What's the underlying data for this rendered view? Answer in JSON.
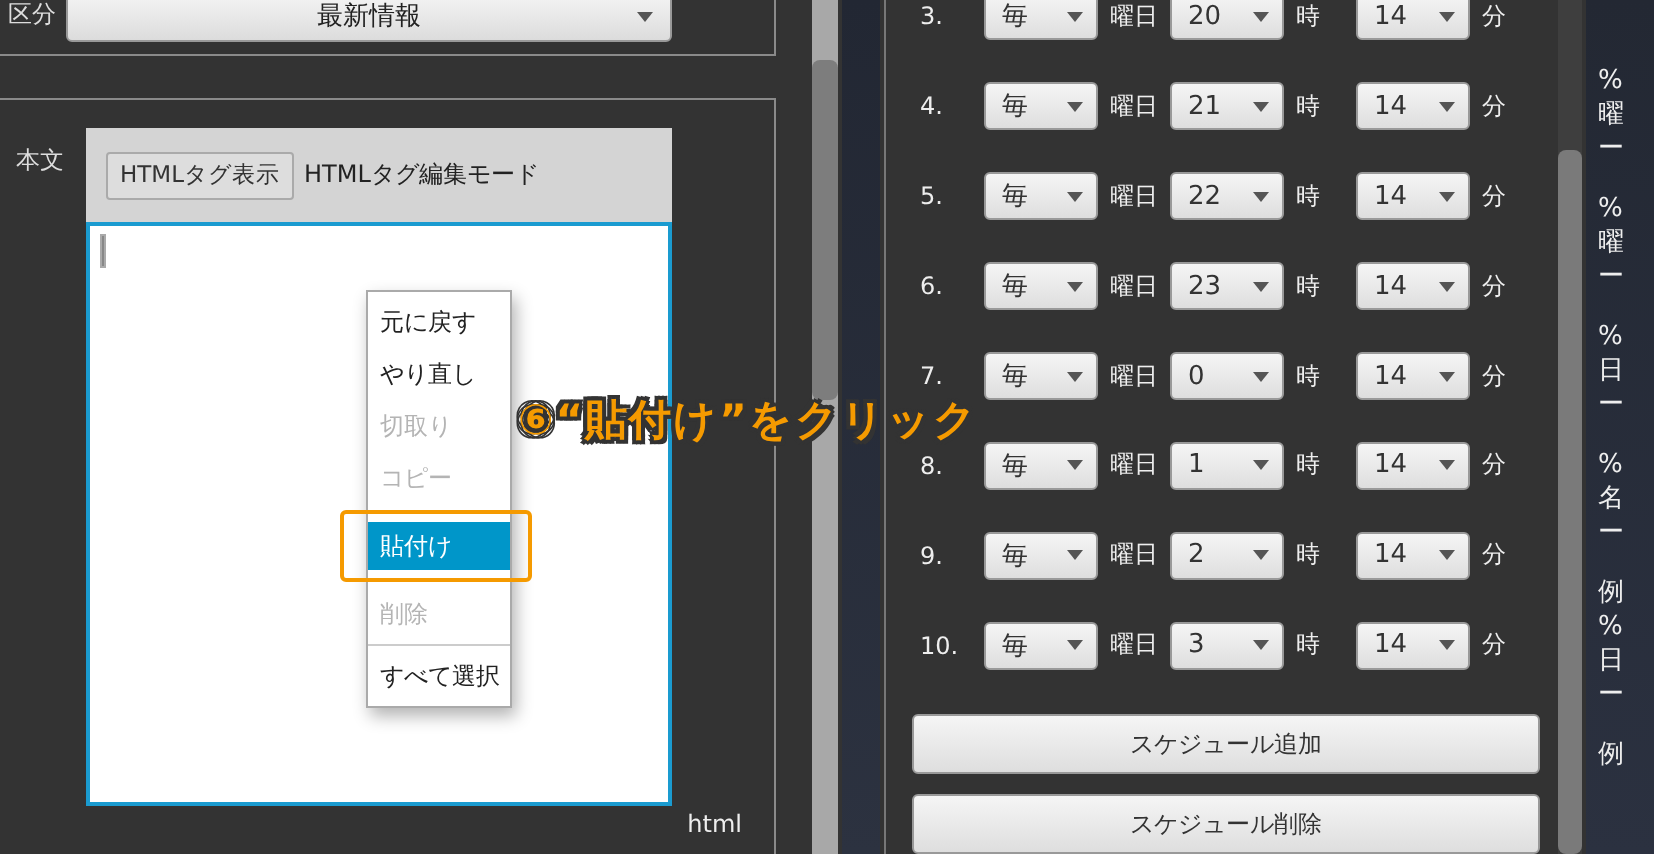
{
  "category_field": {
    "label": "区分",
    "value": "最新情報"
  },
  "body_editor": {
    "label": "本文",
    "toggle_button": "HTMLタグ表示",
    "mode_label": "HTMLタグ編集モード",
    "footer": "html"
  },
  "context_menu": {
    "items": [
      {
        "kind": "item",
        "label": "元に戻す",
        "disabled": false,
        "selected": false
      },
      {
        "kind": "item",
        "label": "やり直し",
        "disabled": false,
        "selected": false
      },
      {
        "kind": "item",
        "label": "切取り",
        "disabled": true,
        "selected": false
      },
      {
        "kind": "item",
        "label": "コピー",
        "disabled": true,
        "selected": false
      },
      {
        "kind": "item",
        "label": "貼付け",
        "disabled": false,
        "selected": true
      },
      {
        "kind": "item",
        "label": "削除",
        "disabled": true,
        "selected": false
      },
      {
        "kind": "separator"
      },
      {
        "kind": "item",
        "label": "すべて選択",
        "disabled": false,
        "selected": false
      }
    ]
  },
  "annotation": {
    "text": "⑥“貼付け”をクリック"
  },
  "schedule": {
    "rows": [
      {
        "number": "3.",
        "day": "毎",
        "day_unit": "曜日",
        "hour": "20",
        "hour_unit": "時",
        "minute": "14",
        "minute_unit": "分"
      },
      {
        "number": "4.",
        "day": "毎",
        "day_unit": "曜日",
        "hour": "21",
        "hour_unit": "時",
        "minute": "14",
        "minute_unit": "分"
      },
      {
        "number": "5.",
        "day": "毎",
        "day_unit": "曜日",
        "hour": "22",
        "hour_unit": "時",
        "minute": "14",
        "minute_unit": "分"
      },
      {
        "number": "6.",
        "day": "毎",
        "day_unit": "曜日",
        "hour": "23",
        "hour_unit": "時",
        "minute": "14",
        "minute_unit": "分"
      },
      {
        "number": "7.",
        "day": "毎",
        "day_unit": "曜日",
        "hour": "0",
        "hour_unit": "時",
        "minute": "14",
        "minute_unit": "分"
      },
      {
        "number": "8.",
        "day": "毎",
        "day_unit": "曜日",
        "hour": "1",
        "hour_unit": "時",
        "minute": "14",
        "minute_unit": "分"
      },
      {
        "number": "9.",
        "day": "毎",
        "day_unit": "曜日",
        "hour": "2",
        "hour_unit": "時",
        "minute": "14",
        "minute_unit": "分"
      },
      {
        "number": "10.",
        "day": "毎",
        "day_unit": "曜日",
        "hour": "3",
        "hour_unit": "時",
        "minute": "14",
        "minute_unit": "分"
      }
    ],
    "buttons": [
      "スケジュール追加",
      "スケジュール削除"
    ]
  },
  "right_panel": {
    "groups": [
      [
        "%",
        "曜",
        "ー"
      ],
      [
        "%",
        "曜",
        "ー"
      ],
      [
        "%",
        "日",
        "ー"
      ],
      [
        "%",
        "名",
        "ー"
      ],
      [
        "例",
        "%",
        "日",
        "ー"
      ],
      [
        "例"
      ]
    ]
  }
}
